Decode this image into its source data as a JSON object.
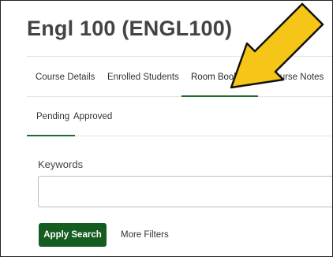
{
  "page": {
    "title": "Engl 100 (ENGL100)"
  },
  "tabs": [
    {
      "label": "Course Details"
    },
    {
      "label": "Enrolled Students"
    },
    {
      "label": "Room Bookings",
      "active": true
    },
    {
      "label": "Course Notes"
    }
  ],
  "subtabs": [
    {
      "label": "Pending",
      "active": true
    },
    {
      "label": "Approved"
    }
  ],
  "search": {
    "label": "Keywords",
    "value": "",
    "placeholder": ""
  },
  "actions": {
    "apply_label": "Apply Search",
    "more_filters_label": "More Filters"
  },
  "colors": {
    "accent": "#155c20",
    "arrow_fill": "#f5c518",
    "arrow_outline": "#111111"
  },
  "annotation": {
    "icon": "pointer-arrow-icon"
  }
}
